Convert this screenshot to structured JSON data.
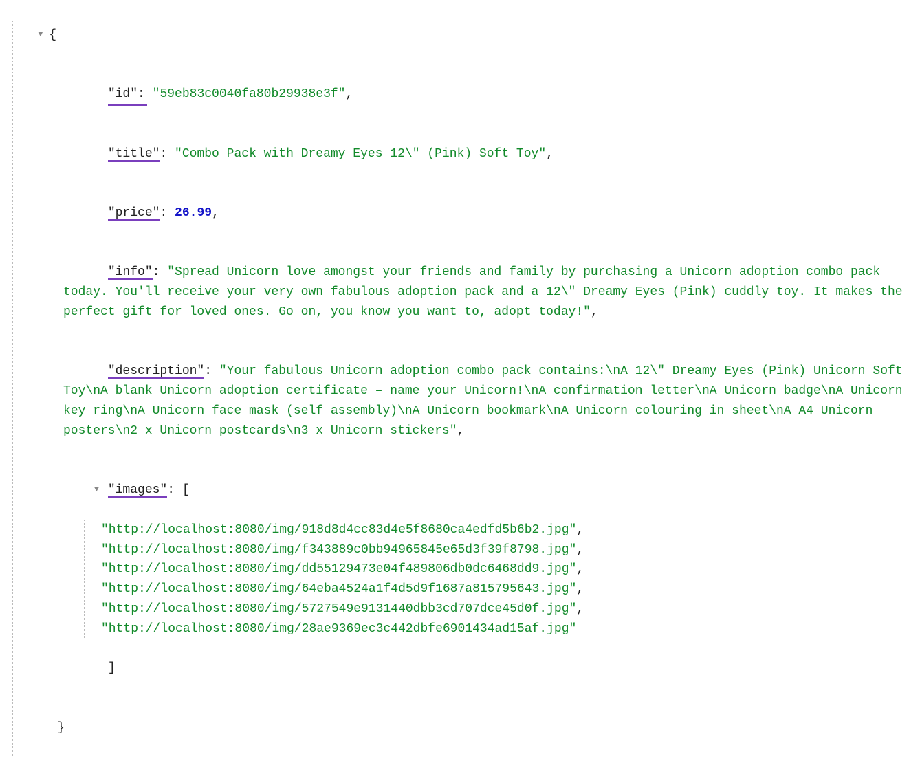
{
  "json": {
    "keys": {
      "id": "\"id\"",
      "title": "\"title\"",
      "price": "\"price\"",
      "info": "\"info\"",
      "description": "\"description\"",
      "images": "\"images\""
    },
    "values": {
      "id": "\"59eb83c0040fa80b29938e3f\"",
      "title": "\"Combo Pack with Dreamy Eyes 12\\\" (Pink) Soft Toy\"",
      "price": "26.99",
      "info": "\"Spread Unicorn love amongst your friends and family by purchasing a Unicorn adoption combo pack today. You'll receive your very own fabulous adoption pack and a 12\\\" Dreamy Eyes (Pink) cuddly toy. It makes the perfect gift for loved ones. Go on, you know you want to, adopt today!\"",
      "description": "\"Your fabulous Unicorn adoption combo pack contains:\\nA 12\\\" Dreamy Eyes (Pink) Unicorn Soft Toy\\nA blank Unicorn adoption certificate – name your Unicorn!\\nA confirmation letter\\nA Unicorn badge\\nA Unicorn key ring\\nA Unicorn face mask (self assembly)\\nA Unicorn bookmark\\nA Unicorn colouring in sheet\\nA A4 Unicorn posters\\n2 x Unicorn postcards\\n3 x Unicorn stickers\"",
      "images": [
        "\"http://localhost:8080/img/918d8d4cc83d4e5f8680ca4edfd5b6b2.jpg\"",
        "\"http://localhost:8080/img/f343889c0bb94965845e65d3f39f8798.jpg\"",
        "\"http://localhost:8080/img/dd55129473e04f489806db0dc6468dd9.jpg\"",
        "\"http://localhost:8080/img/64eba4524a1f4d5d9f1687a815795643.jpg\"",
        "\"http://localhost:8080/img/5727549e9131440dbb3cd707dce45d0f.jpg\"",
        "\"http://localhost:8080/img/28ae9369ec3c442dbfe6901434ad15af.jpg\""
      ]
    },
    "braces": {
      "open": "{",
      "close": "}",
      "arr_open": "[",
      "arr_close": "]"
    },
    "colon": ": ",
    "comma": ",",
    "toggle_glyph": "▼"
  }
}
